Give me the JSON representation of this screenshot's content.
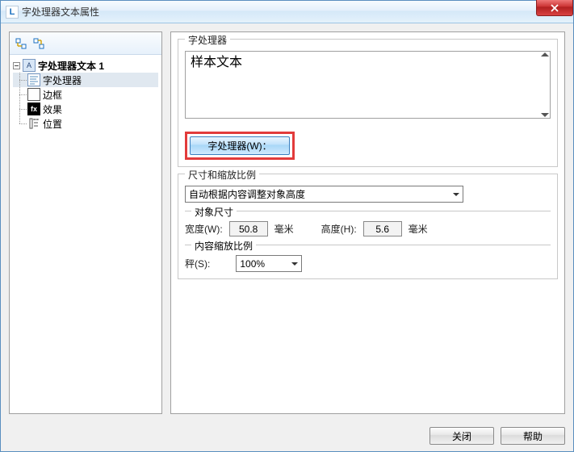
{
  "window": {
    "title": "字处理器文本属性"
  },
  "tree": {
    "root_label": "字处理器文本 1",
    "items": [
      {
        "label": "字处理器"
      },
      {
        "label": "边框"
      },
      {
        "label": "效果"
      },
      {
        "label": "位置"
      }
    ]
  },
  "right": {
    "group1_legend": "字处理器",
    "sample_text": "样本文本",
    "wp_button": "字处理器(W)：",
    "group2_legend": "尺寸和缩放比例",
    "combo_value": "自动根据内容调整对象高度",
    "obj_size_legend": "对象尺寸",
    "width_label": "宽度(W):",
    "width_value": "50.8",
    "mm1": "毫米",
    "height_label": "高度(H):",
    "height_value": "5.6",
    "mm2": "毫米",
    "scale_legend": "内容缩放比例",
    "scale_label": "秤(S):",
    "scale_value": "100%"
  },
  "footer": {
    "close": "关闭",
    "help": "帮助"
  }
}
